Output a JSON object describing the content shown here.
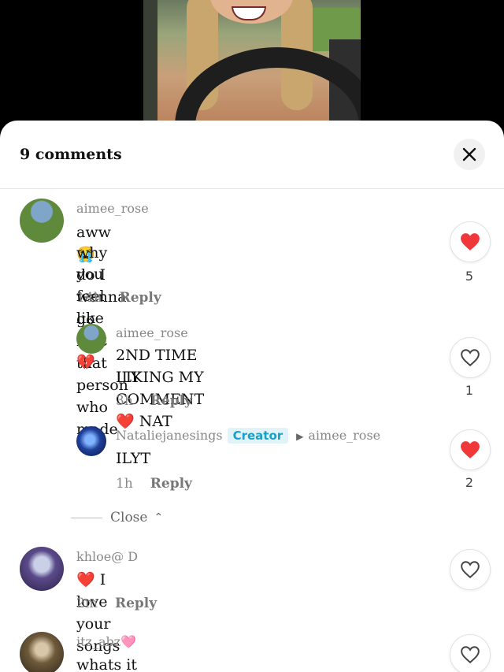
{
  "video": {},
  "header": {
    "count_label": "9 comments"
  },
  "comments": [
    {
      "username": "aimee_rose",
      "line1": "aww 😭",
      "line2": "why do I wanna go find that person who made",
      "line3": "you feel like that 💔",
      "time": "14h",
      "reply": "Reply",
      "likes": "5",
      "liked": true
    },
    {
      "username": "aimee_rose",
      "line1": "2ND TIME LIKING MY COMMENT ❤️  NAT",
      "line2": "ILY",
      "time": "3h",
      "reply": "Reply",
      "likes": "1",
      "liked": false
    },
    {
      "username": "Nataliejanesings",
      "badge": "Creator",
      "reply_to": "aimee_rose",
      "line1": "ILYT",
      "time": "1h",
      "reply": "Reply",
      "likes": "2",
      "liked": true
    },
    {
      "username": "khloe@ D",
      "line1": "❤️ I love your songs",
      "time": "2m",
      "reply": "Reply",
      "liked": false
    },
    {
      "username": "itz_abz🩷",
      "line1": "whats it called??",
      "liked": false
    }
  ],
  "thread": {
    "close_label": "Close"
  },
  "colors": {
    "like_red": "#f0383a",
    "creator_badge": "#1aa0c8"
  }
}
